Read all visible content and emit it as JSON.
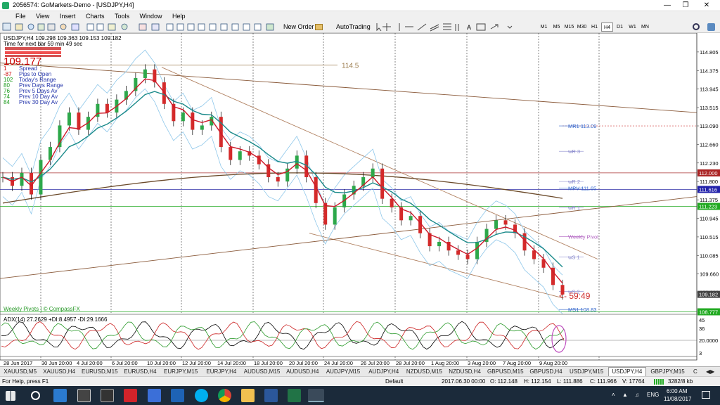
{
  "window": {
    "title": "2056574: GoMarkets-Demo - [USDJPY,H4]",
    "menu": [
      "File",
      "View",
      "Insert",
      "Charts",
      "Tools",
      "Window",
      "Help"
    ]
  },
  "toolbar": {
    "new_order": "New Order",
    "auto_trading": "AutoTrading",
    "timeframes": [
      "M1",
      "M5",
      "M15",
      "M30",
      "H1",
      "H4",
      "D1",
      "W1",
      "MN"
    ]
  },
  "chart_info": {
    "header": "USDJPY,H4  109.298 109.363 109.153 109.182",
    "next_bar": "Time for next bar 59 min 49 sec",
    "price_big": "109.177",
    "stats": [
      {
        "value": "1",
        "label": "Spread",
        "color": "#cc0000"
      },
      {
        "value": "-87",
        "label": "Pips to Open",
        "color": "#cc0000"
      },
      {
        "value": "102",
        "label": "Today's Range",
        "color": "#1a9a1a"
      },
      {
        "value": "80",
        "label": "Prev Days Range",
        "color": "#1a9a1a"
      },
      {
        "value": "76",
        "label": "Prev 5 Days Av",
        "color": "#1a9a1a"
      },
      {
        "value": "74",
        "label": "Prev 10 Day Av",
        "color": "#1a9a1a"
      },
      {
        "value": "84",
        "label": "Prev 30 Day Av",
        "color": "#1a9a1a"
      }
    ],
    "footer": "Weekly Pivots | © CompassFX",
    "adx_label": "ADX(14) 27.2629 +DI:8.4957 -DI:29.1666",
    "countdown": "<- 59:49"
  },
  "chart_data": {
    "type": "line",
    "symbol": "USDJPY",
    "timeframe": "H4",
    "price_axis": [
      "114.805",
      "114.375",
      "113.945",
      "113.515",
      "113.090",
      "112.660",
      "112.230",
      "111.800",
      "111.375",
      "110.945",
      "110.515",
      "110.085",
      "109.660",
      "109.230"
    ],
    "time_axis": [
      "28 Jun 2017",
      "30 Jun 20:00",
      "4 Jul 20:00",
      "6 Jul 20:00",
      "10 Jul 20:00",
      "12 Jul 20:00",
      "14 Jul 20:00",
      "18 Jul 20:00",
      "20 Jul 20:00",
      "24 Jul 20:00",
      "26 Jul 20:00",
      "28 Jul 20:00",
      "1 Aug 20:00",
      "3 Aug 20:00",
      "7 Aug 20:00",
      "9 Aug 20:00"
    ],
    "ylim": [
      108.85,
      114.95
    ],
    "price_series": [
      111.9,
      111.7,
      112.0,
      111.5,
      112.3,
      112.6,
      113.1,
      113.4,
      113.0,
      113.3,
      113.6,
      113.4,
      113.7,
      113.9,
      114.2,
      114.4,
      114.1,
      113.6,
      113.2,
      113.4,
      113.0,
      113.1,
      113.3,
      112.6,
      112.3,
      112.5,
      112.4,
      112.2,
      111.9,
      111.8,
      112.1,
      112.4,
      111.9,
      111.3,
      110.8,
      111.2,
      111.5,
      111.7,
      111.9,
      112.1,
      111.4,
      111.2,
      110.9,
      111.0,
      110.6,
      110.3,
      110.4,
      110.2,
      110.1,
      110.0,
      110.4,
      110.7,
      110.9,
      110.8,
      110.6,
      110.2,
      110.0,
      109.8,
      109.4,
      109.18
    ],
    "levels": [
      {
        "label": "114.5",
        "value": 114.5,
        "color": "#9a7a4a"
      },
      {
        "label": "MR1  113.09",
        "value": 113.09,
        "color": "#3366cc"
      },
      {
        "label": "wR 3",
        "value": 112.5,
        "color": "#8888cc"
      },
      {
        "label": "MPV  111.65",
        "value": 111.65,
        "color": "#3366cc"
      },
      {
        "label": "wR 2",
        "value": 111.8,
        "color": "#8888cc"
      },
      {
        "label": "wR 1",
        "value": 111.2,
        "color": "#8888cc"
      },
      {
        "label": "Weekly Pivot",
        "value": 110.52,
        "color": "#b060c0"
      },
      {
        "label": "wS 1",
        "value": 110.05,
        "color": "#8888cc"
      },
      {
        "label": "wS 2",
        "value": 109.25,
        "color": "#8888cc"
      },
      {
        "label": "MS1  108.83",
        "value": 108.83,
        "color": "#3366cc"
      }
    ],
    "axis_markers": [
      {
        "label": "112.000",
        "value": 112.0,
        "color": "#aa2222"
      },
      {
        "label": "111.616",
        "value": 111.616,
        "color": "#2222aa"
      },
      {
        "label": "111.223",
        "value": 111.223,
        "color": "#22aa22"
      },
      {
        "label": "109.182",
        "value": 109.182,
        "color": "#444444"
      },
      {
        "label": "108.777",
        "value": 108.777,
        "color": "#22aa22"
      }
    ],
    "adx_axis": [
      "45",
      "36",
      "20.0000",
      "3"
    ]
  },
  "tabs": {
    "items": [
      "XAUUSD,M5",
      "XAUUSD,H4",
      "EURUSD,M15",
      "EURUSD,H4",
      "EURJPY,M15",
      "EURJPY,H4",
      "AUDUSD,M15",
      "AUDUSD,H4",
      "AUDJPY,M15",
      "AUDJPY,H4",
      "NZDUSD,M15",
      "NZDUSD,H4",
      "GBPUSD,M15",
      "GBPUSD,H4",
      "USDJPY,M15",
      "USDJPY,H4",
      "GBPJPY,M15",
      "C"
    ],
    "active": "USDJPY,H4"
  },
  "status": {
    "help": "For Help, press F1",
    "profile": "Default",
    "datetime": "2017.06.30 00:00",
    "open": "O: 112.148",
    "high": "H: 112.154",
    "low": "L: 111.886",
    "close": "C: 111.966",
    "volume": "V: 17764",
    "traffic": "3282/8 kb"
  },
  "taskbar": {
    "lang": "ENG",
    "time": "6:00 AM",
    "date": "11/08/2017"
  }
}
